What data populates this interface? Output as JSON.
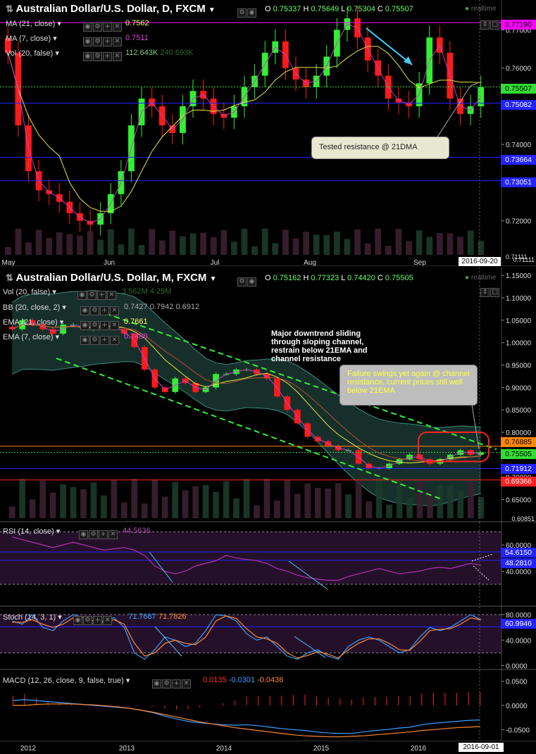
{
  "top_chart": {
    "title": "Australian Dollar/U.S. Dollar, D, FXCM",
    "ohlc": {
      "o_label": "O",
      "o": "0.75337",
      "h_label": "H",
      "h": "0.75649",
      "l_label": "L",
      "l": "0.75304",
      "c_label": "C",
      "c": "0.75507"
    },
    "realtime": "realtime",
    "indicators": [
      {
        "label": "MA (21, close)",
        "value": "0.7562",
        "color": "#ffff66"
      },
      {
        "label": "MA (7, close)",
        "value": "0.7511",
        "color": "#e040e0"
      },
      {
        "label": "Vol (20, false)",
        "value": "112.643K",
        "value2": "240.693K",
        "color": "#7fd07f"
      }
    ],
    "price_tags": [
      {
        "text": "0.77190",
        "bg": "#ff00ff",
        "fg": "#000",
        "price": 0.7719
      },
      {
        "text": "0.75507",
        "bg": "#33dd33",
        "fg": "#000",
        "price": 0.75507
      },
      {
        "text": "0.75082",
        "bg": "#2323ff",
        "fg": "#fff",
        "price": 0.75082
      },
      {
        "text": "0.73664",
        "bg": "#2323ff",
        "fg": "#fff",
        "price": 0.73664
      },
      {
        "text": "0.73051",
        "bg": "#2323ff",
        "fg": "#fff",
        "price": 0.73051
      }
    ],
    "annotation": "Tested resistance @ 21DMA",
    "date_badge": "2016-09-20",
    "last_tick": "0.71111"
  },
  "bottom_chart": {
    "title": "Australian Dollar/U.S. Dollar, M, FXCM",
    "ohlc": {
      "o_label": "O",
      "o": "0.75162",
      "h_label": "H",
      "h": "0.77323",
      "l_label": "L",
      "l": "0.74420",
      "c_label": "C",
      "c": "0.75505"
    },
    "realtime": "realtime",
    "indicators": [
      {
        "label": "Vol (20, false)",
        "value": "3.562M",
        "value2": "4.25M",
        "color": "#7fd07f"
      },
      {
        "label": "BB (20, close, 2)",
        "value": "0.7427",
        "value2": "0.7942",
        "value3": "0.6912",
        "color": "#aaaaaa"
      },
      {
        "label": "EMA (21, close)",
        "value": "0.7661",
        "color": "#ffff66"
      },
      {
        "label": "EMA (7, close)",
        "value": "0.7480",
        "color": "#e040e0"
      }
    ],
    "price_tags": [
      {
        "text": "0.76885",
        "bg": "#ff8800",
        "fg": "#000",
        "price": 0.76885
      },
      {
        "text": "0.75505",
        "bg": "#33dd33",
        "fg": "#000",
        "price": 0.75505
      },
      {
        "text": "0.71912",
        "bg": "#2323ff",
        "fg": "#fff",
        "price": 0.71912
      },
      {
        "text": "0.69366",
        "bg": "#ff2020",
        "fg": "#fff",
        "price": 0.69366
      }
    ],
    "annotation_major": "Major downtrend sliding through sloping channel, restrain below 21EMA and channel resistance",
    "annotation_failure": "Failure swings yet again @ channel resistance, current prices still well below 21EMA",
    "last_tick": "0.60851"
  },
  "rsi": {
    "label": "RSI (14, close)",
    "value": "44.5636",
    "tags": [
      {
        "text": "54.6150",
        "bg": "#2323ff",
        "fg": "#fff"
      },
      {
        "text": "48.2810",
        "bg": "#2323ff",
        "fg": "#fff"
      }
    ]
  },
  "stoch": {
    "label": "Stoch (14, 3, 1)",
    "value1": "71.7687",
    "value2": "71.7826",
    "tags": [
      {
        "text": "60.9946",
        "bg": "#2323ff",
        "fg": "#fff"
      }
    ]
  },
  "macd": {
    "label": "MACD (12, 26, close, 9, false, true)",
    "value1": "0.0135",
    "value2": "-0.0301",
    "value3": "-0.0436",
    "date_badge": "2016-09-01"
  },
  "chart_data": [
    {
      "type": "candlestick",
      "title": "Australian Dollar/U.S. Dollar, D, FXCM",
      "x_ticks": [
        "May",
        "Jun",
        "Jul",
        "Aug",
        "Sep"
      ],
      "y_ticks": [
        0.77,
        0.76,
        0.75,
        0.74,
        0.73,
        0.72
      ],
      "ylim": [
        0.7111,
        0.7745
      ],
      "series": [
        {
          "name": "MA (21, close)",
          "last": 0.7562
        },
        {
          "name": "MA (7, close)",
          "last": 0.7511
        }
      ],
      "close_path": [
        0.764,
        0.745,
        0.733,
        0.728,
        0.727,
        0.725,
        0.722,
        0.72,
        0.719,
        0.722,
        0.727,
        0.733,
        0.745,
        0.752,
        0.75,
        0.745,
        0.743,
        0.75,
        0.754,
        0.752,
        0.748,
        0.747,
        0.75,
        0.755,
        0.758,
        0.764,
        0.767,
        0.76,
        0.757,
        0.755,
        0.758,
        0.763,
        0.77,
        0.773,
        0.768,
        0.762,
        0.758,
        0.752,
        0.751,
        0.75,
        0.756,
        0.768,
        0.764,
        0.752,
        0.748,
        0.75,
        0.755
      ],
      "horizontal_levels": [
        0.7719,
        0.75507,
        0.75082,
        0.73664,
        0.73051
      ]
    },
    {
      "type": "candlestick",
      "title": "Australian Dollar/U.S. Dollar, M, FXCM",
      "x_ticks": [
        "2012",
        "2013",
        "2014",
        "2015",
        "2016"
      ],
      "y_ticks": [
        1.15,
        1.1,
        1.05,
        1.0,
        0.95,
        0.9,
        0.85,
        0.8,
        0.75,
        0.7,
        0.65
      ],
      "ylim": [
        0.6085,
        1.155
      ],
      "series": [
        {
          "name": "BB (20, close, 2)",
          "values": [
            0.7427,
            0.7942,
            0.6912
          ]
        },
        {
          "name": "EMA (21, close)",
          "last": 0.7661
        },
        {
          "name": "EMA (7, close)",
          "last": 0.748
        }
      ],
      "close_path": [
        1.03,
        1.05,
        1.04,
        1.03,
        1.02,
        1.04,
        1.04,
        1.03,
        1.04,
        1.04,
        1.03,
        1.02,
        0.99,
        0.94,
        0.9,
        0.89,
        0.92,
        0.91,
        0.89,
        0.9,
        0.93,
        0.93,
        0.94,
        0.94,
        0.93,
        0.92,
        0.88,
        0.85,
        0.82,
        0.79,
        0.78,
        0.77,
        0.76,
        0.76,
        0.73,
        0.72,
        0.72,
        0.73,
        0.74,
        0.75,
        0.74,
        0.73,
        0.74,
        0.75,
        0.76,
        0.75,
        0.755
      ],
      "horizontal_levels": [
        0.76885,
        0.75505,
        0.71912,
        0.69366
      ]
    },
    {
      "type": "line",
      "title": "RSI (14, close)",
      "y_ticks": [
        60,
        40
      ],
      "ylim": [
        15,
        75
      ],
      "values": [
        66,
        64,
        62,
        60,
        58,
        60,
        62,
        60,
        58,
        56,
        57,
        58,
        56,
        52,
        44,
        40,
        38,
        40,
        44,
        46,
        48,
        52,
        50,
        49,
        48,
        46,
        42,
        40,
        37,
        35,
        34,
        33,
        33,
        36,
        38,
        40,
        42,
        40,
        38,
        39,
        40,
        42,
        43,
        42,
        44,
        46,
        44.56
      ],
      "horizontal_levels": [
        54.615,
        48.281
      ]
    },
    {
      "type": "line",
      "title": "Stoch (14, 3, 1)",
      "y_ticks": [
        80,
        40,
        0
      ],
      "ylim": [
        -5,
        90
      ],
      "series": [
        {
          "name": "%K",
          "values": [
            70,
            65,
            80,
            60,
            55,
            70,
            80,
            75,
            65,
            70,
            75,
            60,
            20,
            10,
            25,
            45,
            40,
            30,
            35,
            55,
            80,
            78,
            70,
            50,
            40,
            45,
            30,
            15,
            10,
            20,
            25,
            15,
            10,
            30,
            40,
            45,
            40,
            30,
            20,
            25,
            45,
            60,
            55,
            60,
            70,
            80,
            71.77
          ]
        },
        {
          "name": "%D",
          "values": [
            68,
            68,
            72,
            65,
            60,
            65,
            75,
            76,
            70,
            68,
            72,
            65,
            35,
            15,
            20,
            35,
            40,
            35,
            33,
            45,
            70,
            78,
            74,
            58,
            45,
            42,
            35,
            20,
            12,
            16,
            22,
            18,
            12,
            25,
            35,
            42,
            42,
            35,
            25,
            24,
            38,
            55,
            57,
            58,
            65,
            75,
            71.78
          ]
        }
      ],
      "horizontal_levels": [
        60.9946
      ]
    },
    {
      "type": "line",
      "title": "MACD (12, 26, close, 9, false, true)",
      "y_ticks": [
        0.05,
        0.0,
        -0.05
      ],
      "ylim": [
        -0.07,
        0.07
      ],
      "series": [
        {
          "name": "MACD",
          "values": [
            0.01,
            0.012,
            0.01,
            0.008,
            0.006,
            0.004,
            0.002,
            0.0,
            -0.002,
            -0.004,
            -0.006,
            -0.01,
            -0.015,
            -0.022,
            -0.028,
            -0.033,
            -0.036,
            -0.038,
            -0.04,
            -0.041,
            -0.04,
            -0.042,
            -0.045,
            -0.048,
            -0.05,
            -0.052,
            -0.055,
            -0.057,
            -0.058,
            -0.058,
            -0.055,
            -0.052,
            -0.05,
            -0.047,
            -0.045,
            -0.04,
            -0.037,
            -0.035,
            -0.033,
            -0.031,
            -0.0301
          ]
        },
        {
          "name": "Signal",
          "values": [
            0.0,
            0.0,
            0.002,
            0.003,
            0.003,
            0.003,
            0.002,
            0.001,
            -0.001,
            -0.003,
            -0.006,
            -0.01,
            -0.014,
            -0.019,
            -0.024,
            -0.029,
            -0.034,
            -0.038,
            -0.042,
            -0.046,
            -0.049,
            -0.052,
            -0.055,
            -0.058,
            -0.061,
            -0.063,
            -0.064,
            -0.065,
            -0.065,
            -0.064,
            -0.063,
            -0.061,
            -0.059,
            -0.057,
            -0.055,
            -0.052,
            -0.05,
            -0.048,
            -0.046,
            -0.045,
            -0.0436
          ]
        }
      ]
    }
  ]
}
